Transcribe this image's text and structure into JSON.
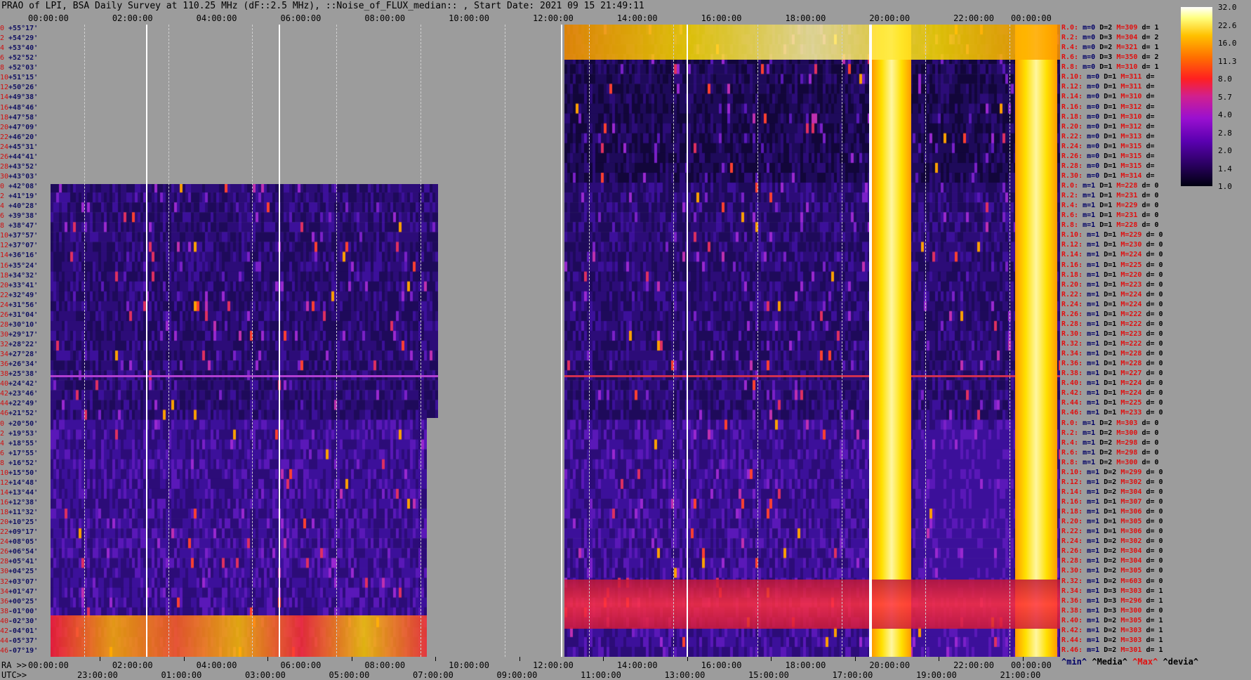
{
  "title": "PRAO of LPI, BSA Daily Survey at 110.25 MHz (dF::2.5 MHz), ::Noise_of_FLUX_median:: , Start Date: 2021 09 15 21:49:11",
  "top_ticks": [
    "00:00:00",
    "02:00:00",
    "04:00:00",
    "06:00:00",
    "08:00:00",
    "10:00:00",
    "12:00:00",
    "14:00:00",
    "16:00:00",
    "18:00:00",
    "20:00:00",
    "22:00:00",
    "00:00:00"
  ],
  "ra_label": "RA >>",
  "utc_label": "UTC>>",
  "ra_ticks": [
    "00:00:00",
    "02:00:00",
    "04:00:00",
    "06:00:00",
    "08:00:00",
    "10:00:00",
    "12:00:00",
    "14:00:00",
    "16:00:00",
    "18:00:00",
    "20:00:00",
    "22:00:00",
    "00:00:00"
  ],
  "utc_ticks": [
    "23:00:00",
    "01:00:00",
    "03:00:00",
    "05:00:00",
    "07:00:00",
    "09:00:00",
    "11:00:00",
    "13:00:00",
    "15:00:00",
    "17:00:00",
    "19:00:00",
    "21:00:00"
  ],
  "declinations": [
    "+55°17'",
    "+54°29'",
    "+53°40'",
    "+52°52'",
    "+52°03'",
    "+51°15'",
    "+50°26'",
    "+49°38'",
    "+48°46'",
    "+47°58'",
    "+47°09'",
    "+46°20'",
    "+45°31'",
    "+44°41'",
    "+43°52'",
    "+43°03'",
    "+42°08'",
    "+41°19'",
    "+40°28'",
    "+39°38'",
    "+38°47'",
    "+37°57'",
    "+37°07'",
    "+36°16'",
    "+35°24'",
    "+34°32'",
    "+33°41'",
    "+32°49'",
    "+31°56'",
    "+31°04'",
    "+30°10'",
    "+29°17'",
    "+28°22'",
    "+27°28'",
    "+26°34'",
    "+25°38'",
    "+24°42'",
    "+23°46'",
    "+22°49'",
    "+21°52'",
    "+20°50'",
    "+19°53'",
    "+18°55'",
    "+17°55'",
    "+16°52'",
    "+15°50'",
    "+14°48'",
    "+13°44'",
    "+12°38'",
    "+11°32'",
    "+10°25'",
    "+09°17'",
    "+08°05'",
    "+06°54'",
    "+05°41'",
    "+04°25'",
    "+03°07'",
    "+01°47'",
    "+00°25'",
    "-01°00'",
    "-02°30'",
    "-04°01'",
    "-05°37'",
    "-07°19'"
  ],
  "row_indices": [
    "0",
    "2",
    "4",
    "6",
    "8",
    "10",
    "12",
    "14",
    "16",
    "18",
    "20",
    "22",
    "24",
    "26",
    "28",
    "30",
    "0",
    "2",
    "4",
    "6",
    "8",
    "10",
    "12",
    "14",
    "16",
    "18",
    "20",
    "22",
    "24",
    "26",
    "28",
    "30",
    "32",
    "34",
    "36",
    "38",
    "40",
    "42",
    "44",
    "46",
    "0",
    "2",
    "4",
    "6",
    "8",
    "10",
    "12",
    "14",
    "16",
    "18",
    "20",
    "22",
    "24",
    "26",
    "28",
    "30",
    "32",
    "34",
    "36",
    "38",
    "40",
    "42",
    "44",
    "46"
  ],
  "stats": [
    {
      "r": "R.0:",
      "m": "m=0",
      "D": "D=2",
      "M": "M=309",
      "d": "d= 1"
    },
    {
      "r": "R.2:",
      "m": "m=0",
      "D": "D=3",
      "M": "M=304",
      "d": "d= 2"
    },
    {
      "r": "R.4:",
      "m": "m=0",
      "D": "D=2",
      "M": "M=321",
      "d": "d= 1"
    },
    {
      "r": "R.6:",
      "m": "m=0",
      "D": "D=3",
      "M": "M=350",
      "d": "d= 2"
    },
    {
      "r": "R.8:",
      "m": "m=0",
      "D": "D=1",
      "M": "M=310",
      "d": "d= 1"
    },
    {
      "r": "R.10:",
      "m": "m=0",
      "D": "D=1",
      "M": "M=311",
      "d": "d="
    },
    {
      "r": "R.12:",
      "m": "m=0",
      "D": "D=1",
      "M": "M=311",
      "d": "d="
    },
    {
      "r": "R.14:",
      "m": "m=0",
      "D": "D=1",
      "M": "M=310",
      "d": "d="
    },
    {
      "r": "R.16:",
      "m": "m=0",
      "D": "D=1",
      "M": "M=312",
      "d": "d="
    },
    {
      "r": "R.18:",
      "m": "m=0",
      "D": "D=1",
      "M": "M=310",
      "d": "d="
    },
    {
      "r": "R.20:",
      "m": "m=0",
      "D": "D=1",
      "M": "M=312",
      "d": "d="
    },
    {
      "r": "R.22:",
      "m": "m=0",
      "D": "D=1",
      "M": "M=313",
      "d": "d="
    },
    {
      "r": "R.24:",
      "m": "m=0",
      "D": "D=1",
      "M": "M=315",
      "d": "d="
    },
    {
      "r": "R.26:",
      "m": "m=0",
      "D": "D=1",
      "M": "M=315",
      "d": "d="
    },
    {
      "r": "R.28:",
      "m": "m=0",
      "D": "D=1",
      "M": "M=315",
      "d": "d="
    },
    {
      "r": "R.30:",
      "m": "m=0",
      "D": "D=1",
      "M": "M=314",
      "d": "d="
    },
    {
      "r": "R.0:",
      "m": "m=1",
      "D": "D=1",
      "M": "M=228",
      "d": "d= 0"
    },
    {
      "r": "R.2:",
      "m": "m=1",
      "D": "D=1",
      "M": "M=231",
      "d": "d= 0"
    },
    {
      "r": "R.4:",
      "m": "m=1",
      "D": "D=1",
      "M": "M=229",
      "d": "d= 0"
    },
    {
      "r": "R.6:",
      "m": "m=1",
      "D": "D=1",
      "M": "M=231",
      "d": "d= 0"
    },
    {
      "r": "R.8:",
      "m": "m=1",
      "D": "D=1",
      "M": "M=228",
      "d": "d= 0"
    },
    {
      "r": "R.10:",
      "m": "m=1",
      "D": "D=1",
      "M": "M=229",
      "d": "d= 0"
    },
    {
      "r": "R.12:",
      "m": "m=1",
      "D": "D=1",
      "M": "M=230",
      "d": "d= 0"
    },
    {
      "r": "R.14:",
      "m": "m=1",
      "D": "D=1",
      "M": "M=224",
      "d": "d= 0"
    },
    {
      "r": "R.16:",
      "m": "m=1",
      "D": "D=1",
      "M": "M=225",
      "d": "d= 0"
    },
    {
      "r": "R.18:",
      "m": "m=1",
      "D": "D=1",
      "M": "M=220",
      "d": "d= 0"
    },
    {
      "r": "R.20:",
      "m": "m=1",
      "D": "D=1",
      "M": "M=223",
      "d": "d= 0"
    },
    {
      "r": "R.22:",
      "m": "m=1",
      "D": "D=1",
      "M": "M=224",
      "d": "d= 0"
    },
    {
      "r": "R.24:",
      "m": "m=1",
      "D": "D=1",
      "M": "M=224",
      "d": "d= 0"
    },
    {
      "r": "R.26:",
      "m": "m=1",
      "D": "D=1",
      "M": "M=222",
      "d": "d= 0"
    },
    {
      "r": "R.28:",
      "m": "m=1",
      "D": "D=1",
      "M": "M=222",
      "d": "d= 0"
    },
    {
      "r": "R.30:",
      "m": "m=1",
      "D": "D=1",
      "M": "M=223",
      "d": "d= 0"
    },
    {
      "r": "R.32:",
      "m": "m=1",
      "D": "D=1",
      "M": "M=222",
      "d": "d= 0"
    },
    {
      "r": "R.34:",
      "m": "m=1",
      "D": "D=1",
      "M": "M=228",
      "d": "d= 0"
    },
    {
      "r": "R.36:",
      "m": "m=1",
      "D": "D=1",
      "M": "M=228",
      "d": "d= 0"
    },
    {
      "r": "R.38:",
      "m": "m=1",
      "D": "D=1",
      "M": "M=227",
      "d": "d= 0"
    },
    {
      "r": "R.40:",
      "m": "m=1",
      "D": "D=1",
      "M": "M=224",
      "d": "d= 0"
    },
    {
      "r": "R.42:",
      "m": "m=1",
      "D": "D=1",
      "M": "M=224",
      "d": "d= 0"
    },
    {
      "r": "R.44:",
      "m": "m=1",
      "D": "D=1",
      "M": "M=225",
      "d": "d= 0"
    },
    {
      "r": "R.46:",
      "m": "m=1",
      "D": "D=1",
      "M": "M=233",
      "d": "d= 0"
    },
    {
      "r": "R.0:",
      "m": "m=1",
      "D": "D=2",
      "M": "M=303",
      "d": "d= 0"
    },
    {
      "r": "R.2:",
      "m": "m=1",
      "D": "D=2",
      "M": "M=300",
      "d": "d= 0"
    },
    {
      "r": "R.4:",
      "m": "m=1",
      "D": "D=2",
      "M": "M=298",
      "d": "d= 0"
    },
    {
      "r": "R.6:",
      "m": "m=1",
      "D": "D=2",
      "M": "M=298",
      "d": "d= 0"
    },
    {
      "r": "R.8:",
      "m": "m=1",
      "D": "D=2",
      "M": "M=300",
      "d": "d= 0"
    },
    {
      "r": "R.10:",
      "m": "m=1",
      "D": "D=2",
      "M": "M=299",
      "d": "d= 0"
    },
    {
      "r": "R.12:",
      "m": "m=1",
      "D": "D=2",
      "M": "M=302",
      "d": "d= 0"
    },
    {
      "r": "R.14:",
      "m": "m=1",
      "D": "D=2",
      "M": "M=304",
      "d": "d= 0"
    },
    {
      "r": "R.16:",
      "m": "m=1",
      "D": "D=1",
      "M": "M=307",
      "d": "d= 0"
    },
    {
      "r": "R.18:",
      "m": "m=1",
      "D": "D=1",
      "M": "M=306",
      "d": "d= 0"
    },
    {
      "r": "R.20:",
      "m": "m=1",
      "D": "D=1",
      "M": "M=305",
      "d": "d= 0"
    },
    {
      "r": "R.22:",
      "m": "m=1",
      "D": "D=1",
      "M": "M=306",
      "d": "d= 0"
    },
    {
      "r": "R.24:",
      "m": "m=1",
      "D": "D=2",
      "M": "M=302",
      "d": "d= 0"
    },
    {
      "r": "R.26:",
      "m": "m=1",
      "D": "D=2",
      "M": "M=304",
      "d": "d= 0"
    },
    {
      "r": "R.28:",
      "m": "m=1",
      "D": "D=2",
      "M": "M=304",
      "d": "d= 0"
    },
    {
      "r": "R.30:",
      "m": "m=1",
      "D": "D=2",
      "M": "M=305",
      "d": "d= 0"
    },
    {
      "r": "R.32:",
      "m": "m=1",
      "D": "D=2",
      "M": "M=603",
      "d": "d= 0"
    },
    {
      "r": "R.34:",
      "m": "m=1",
      "D": "D=3",
      "M": "M=303",
      "d": "d= 1"
    },
    {
      "r": "R.36:",
      "m": "m=1",
      "D": "D=3",
      "M": "M=296",
      "d": "d= 1"
    },
    {
      "r": "R.38:",
      "m": "m=1",
      "D": "D=3",
      "M": "M=300",
      "d": "d= 0"
    },
    {
      "r": "R.40:",
      "m": "m=1",
      "D": "D=2",
      "M": "M=305",
      "d": "d= 1"
    },
    {
      "r": "R.42:",
      "m": "m=1",
      "D": "D=2",
      "M": "M=303",
      "d": "d= 1"
    },
    {
      "r": "R.44:",
      "m": "m=1",
      "D": "D=2",
      "M": "M=303",
      "d": "d= 1"
    },
    {
      "r": "R.46:",
      "m": "m=1",
      "D": "D=2",
      "M": "M=301",
      "d": "d= 1"
    }
  ],
  "legend": {
    "min": "^min^",
    "median": "^Media^",
    "max": "^Max^",
    "devia": "^devia^"
  },
  "colorbar_ticks": [
    "32.0",
    "22.6",
    "16.0",
    "11.3",
    "8.0",
    "5.7",
    "4.0",
    "2.8",
    "2.0",
    "1.4",
    "1.0"
  ],
  "colors": {
    "background": "#9c9c9c",
    "dark": "#0a0320",
    "indigo": "#2a0a70",
    "purple": "#7a18c8",
    "red": "#ff2030",
    "yellow": "#ffe000",
    "white": "#ffffff"
  },
  "chart_data": {
    "type": "heatmap",
    "title": "PRAO of LPI, BSA Daily Survey at 110.25 MHz (dF::2.5 MHz), ::Noise_of_FLUX_median:: , Start Date: 2021 09 15 21:49:11",
    "x_axis_top": "RA 00:00:00 – 00:00:00 (2h steps)",
    "x_axis_bottom_ra": "RA 00:00:00 – 00:00:00",
    "x_axis_bottom_utc": "UTC 23:00:00 – 21:00:00",
    "y_axis": "Declination +55°17' to -07°19' (64 beams)",
    "colorbar": [
      32.0,
      22.6,
      16.0,
      11.3,
      8.0,
      5.7,
      4.0,
      2.8,
      2.0,
      1.4,
      1.0
    ],
    "colorbar_scale": "log"
  }
}
